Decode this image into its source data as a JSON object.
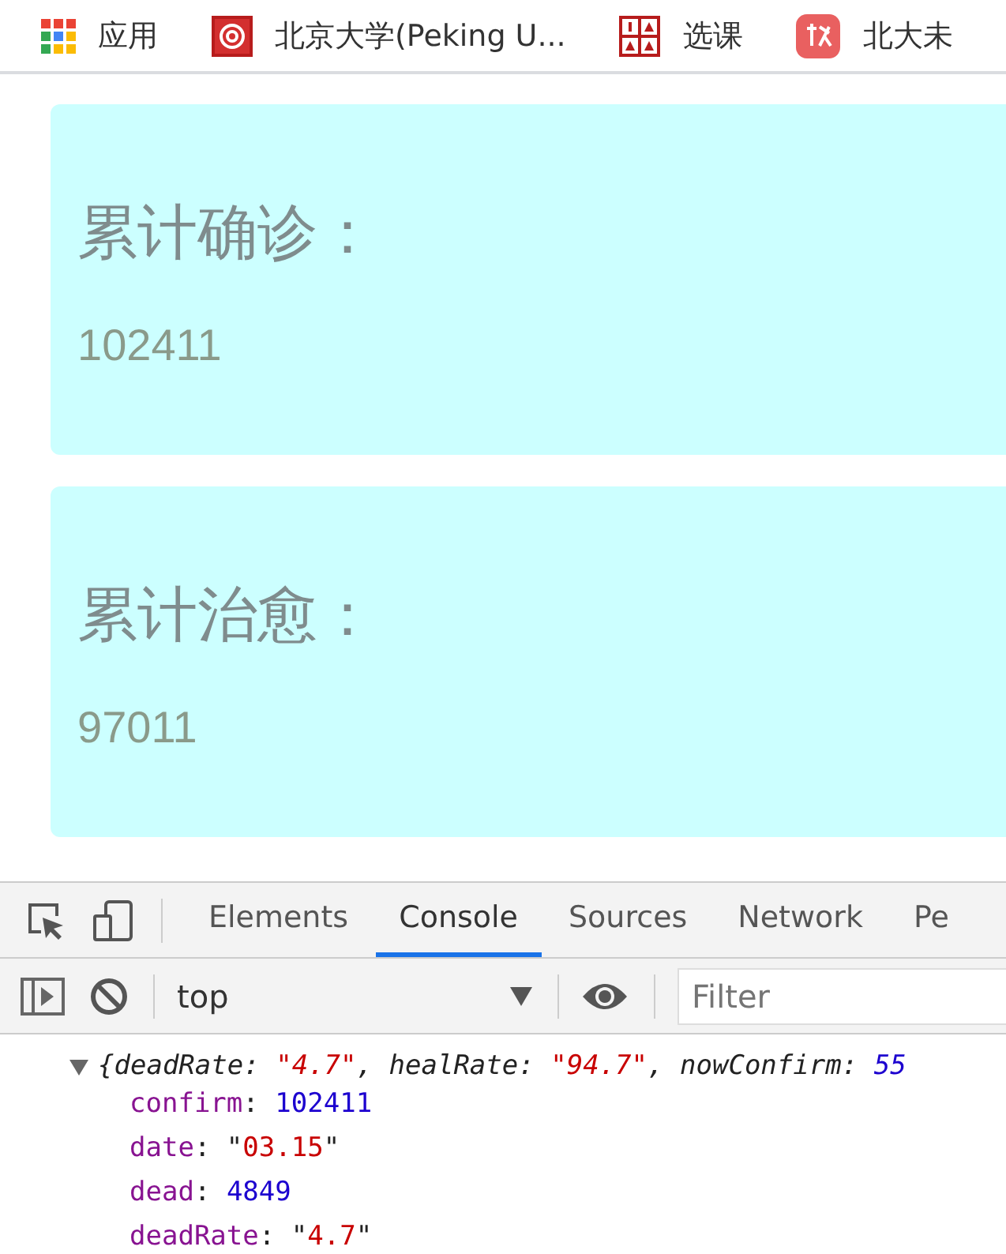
{
  "bookmarks": [
    {
      "kind": "apps",
      "label": "应用"
    },
    {
      "kind": "at",
      "label": "北京大学(Peking U..."
    },
    {
      "kind": "grid",
      "label": "选课"
    },
    {
      "kind": "badge",
      "label": "北大未"
    }
  ],
  "cards": [
    {
      "title": "累计确诊：",
      "value": "102411"
    },
    {
      "title": "累计治愈：",
      "value": "97011"
    }
  ],
  "devtools": {
    "tabs": [
      {
        "label": "Elements",
        "selected": false
      },
      {
        "label": "Console",
        "selected": true
      },
      {
        "label": "Sources",
        "selected": false
      },
      {
        "label": "Network",
        "selected": false
      },
      {
        "label": "Pe",
        "selected": false
      }
    ],
    "context": "top",
    "filter": {
      "placeholder": "Filter"
    },
    "console": {
      "expanded": true,
      "preview": [
        {
          "text": "{deadRate: ",
          "kind": "plain"
        },
        {
          "text": "\"4.7\"",
          "kind": "string"
        },
        {
          "text": ", healRate: ",
          "kind": "plain"
        },
        {
          "text": "\"94.7\"",
          "kind": "string"
        },
        {
          "text": ", nowConfirm: ",
          "kind": "plain"
        },
        {
          "text": "55",
          "kind": "number"
        }
      ],
      "properties": [
        [
          {
            "text": "confirm",
            "kind": "key"
          },
          {
            "text": ": ",
            "kind": "plain"
          },
          {
            "text": "102411",
            "kind": "number"
          }
        ],
        [
          {
            "text": "date",
            "kind": "key"
          },
          {
            "text": ": \"",
            "kind": "plain"
          },
          {
            "text": "03.15",
            "kind": "string"
          },
          {
            "text": "\"",
            "kind": "plain"
          }
        ],
        [
          {
            "text": "dead",
            "kind": "key"
          },
          {
            "text": ": ",
            "kind": "plain"
          },
          {
            "text": "4849",
            "kind": "number"
          }
        ],
        [
          {
            "text": "deadRate",
            "kind": "key"
          },
          {
            "text": ": \"",
            "kind": "plain"
          },
          {
            "text": "4.7",
            "kind": "string"
          },
          {
            "text": "\"",
            "kind": "plain"
          }
        ]
      ]
    }
  }
}
